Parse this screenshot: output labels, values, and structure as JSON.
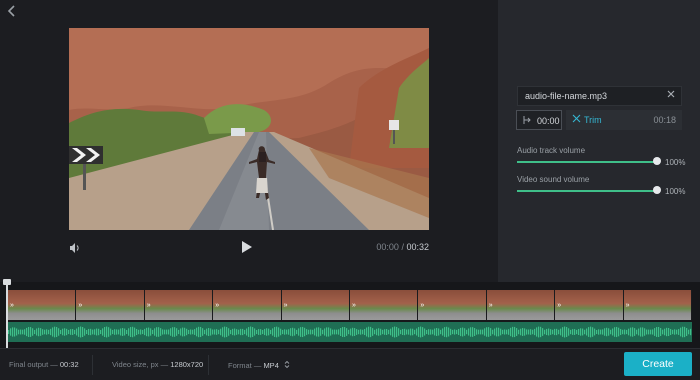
{
  "header": {
    "back_icon": "chevron-left-icon"
  },
  "player": {
    "volume_icon": "speaker-icon",
    "play_icon": "play-icon",
    "current_time": "00:00",
    "separator": "/",
    "total_time": "00:32"
  },
  "audio": {
    "file_name": "audio-file-name.mp3",
    "remove_icon": "close-icon",
    "start_time": "00:00",
    "trim_label": "Trim",
    "trim_end": "00:18",
    "audio_track_label": "Audio track volume",
    "audio_track_value": "100%",
    "audio_track_level": 1.0,
    "video_sound_label": "Video sound volume",
    "video_sound_value": "100%",
    "video_sound_level": 1.0
  },
  "timeline": {
    "thumbnail_count": 10,
    "accent_color": "#3fbf89"
  },
  "bottom": {
    "final_output_label": "Final output —",
    "final_output_value": "00:32",
    "video_size_label": "Video size, px —",
    "video_size_value": "1280x720",
    "format_label": "Format —",
    "format_value": "MP4",
    "create_label": "Create"
  },
  "colors": {
    "accent": "#1bb0c7",
    "trim": "#35b7d3",
    "waveform": "#3fbf89"
  }
}
